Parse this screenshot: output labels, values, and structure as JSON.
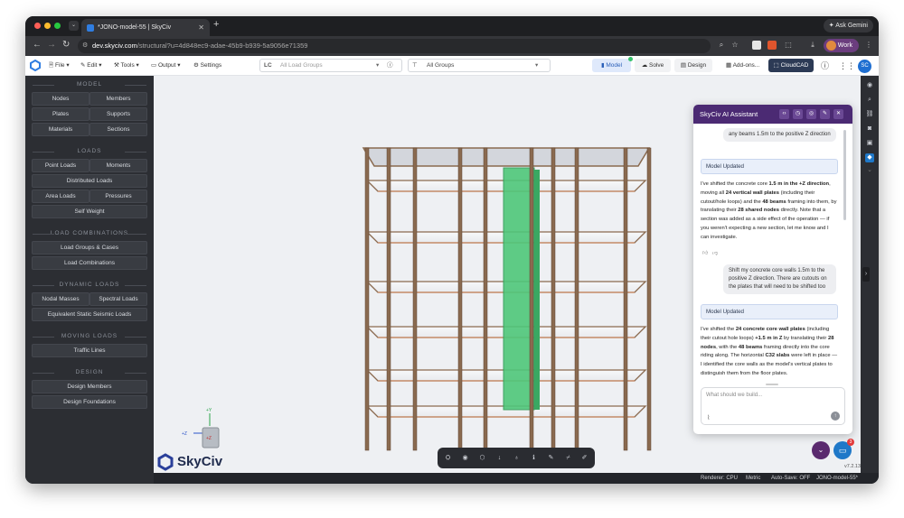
{
  "browser": {
    "tab_title": "*JONO-model-55 | SkyCiv",
    "ask_gemini": "Ask Gemini",
    "url_host": "dev.skyciv.com",
    "url_path": "/structural?u=4d848ec9-adae-45b9-b939-5a9056e71359",
    "profile_label": "Work"
  },
  "header": {
    "menus": [
      "File",
      "Edit",
      "Tools",
      "Output",
      "Settings"
    ],
    "lc_label": "LC",
    "lc_placeholder": "All Load Groups",
    "filter_value": "All Groups",
    "modes": [
      "Model",
      "Solve",
      "Design"
    ],
    "addons": "Add-ons...",
    "cloudcad": "CloudCAD",
    "avatar_initials": "SC"
  },
  "sidebar": {
    "model_heading": "MODEL",
    "model_buttons": [
      "Nodes",
      "Members",
      "Plates",
      "Supports",
      "Materials",
      "Sections"
    ],
    "loads_heading": "LOADS",
    "loads_buttons": [
      "Point Loads",
      "Moments",
      "Distributed Loads",
      "Area Loads",
      "Pressures",
      "Self Weight"
    ],
    "loadcomb_heading": "LOAD COMBINATIONS",
    "loadcomb_buttons": [
      "Load Groups & Cases",
      "Load Combinations"
    ],
    "dynamic_heading": "DYNAMIC LOADS",
    "dynamic_buttons": [
      "Nodal Masses",
      "Spectral Loads",
      "Equivalent Static Seismic Loads"
    ],
    "moving_heading": "MOVING LOADS",
    "moving_buttons": [
      "Traffic Lines"
    ],
    "design_heading": "DESIGN",
    "design_buttons": [
      "Design Members",
      "Design Foundations"
    ]
  },
  "axes": {
    "y": "+Y",
    "z": "+Z",
    "cube_label": "+Z"
  },
  "logo_text": "SkyCiv",
  "ai_panel": {
    "title": "SkyCiv AI Assistant",
    "user_msg_1": "any beams 1.5m to the positive Z direction",
    "model_updated_1": "Model Updated",
    "assistant_msg_1_parts": [
      "I've shifted the concrete core ",
      "1.5 m in the +Z direction",
      ", moving all ",
      "24 vertical wall plates",
      " (including their cutout/hole loops) and the ",
      "48 beams",
      " framing into them, by translating their ",
      "28 shared nodes",
      " directly. Note that a section was added as a side effect of the operation — if you weren't expecting a new section, let me know and I can investigate."
    ],
    "user_msg_2": "Shift my concrete core walls 1.5m to the positive Z direction. There are cutouts on the plates that will need to be shifted too",
    "model_updated_2": "Model Updated",
    "assistant_msg_2_parts": [
      "I've shifted the ",
      "24 concrete core wall plates",
      " (including their cutout hole loops) ",
      "+1.5 m in Z",
      " by translating their ",
      "28 nodes",
      ", with the ",
      "48 beams",
      " framing directly into the core riding along. The horizontal ",
      "C32 slabs",
      " were left in place — I identified the core walls as the model's vertical plates to distinguish them from the floor plates."
    ],
    "input_placeholder": "What should we build..."
  },
  "status_bar": {
    "renderer": "Renderer: CPU",
    "units": "Metric",
    "autosave": "Auto-Save: OFF",
    "file": "JONO-model-55*"
  },
  "version": "v7.2.13",
  "chat_badge": "3",
  "colors": {
    "accent_purple": "#4b2a73",
    "sidebar_bg": "#2c2e33",
    "core_green": "#4fc77a",
    "beam_brown": "#8a6a4f"
  },
  "icons": [
    "back-icon",
    "forward-icon",
    "reload-icon",
    "zoom-icon",
    "star-icon",
    "info-icon",
    "filter-icon",
    "eye-icon",
    "search-icon",
    "camera-icon",
    "chat-icon",
    "paperclip-icon",
    "send-icon",
    "close-icon"
  ]
}
